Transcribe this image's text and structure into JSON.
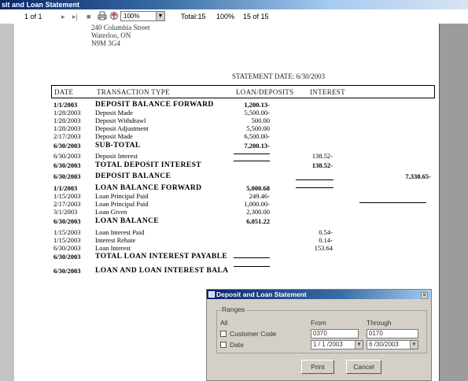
{
  "window": {
    "title": "sit and Loan Statement"
  },
  "toolbar": {
    "page_counter": "1 of 1",
    "next_glyph": "▸",
    "last_glyph": "▸|",
    "stop_glyph": "■",
    "zoom_value": "100%",
    "total_label": "Total:15",
    "total_pct": "100%",
    "records_label": "15 of 15"
  },
  "report": {
    "address": [
      "240 Columbia Street",
      "Waterloo, ON",
      "N9M 3G4"
    ],
    "statement_date": "STATEMENT DATE: 6/30/2003",
    "headers": {
      "date": "DATE",
      "type": "TRANSACTION TYPE",
      "loan": "LOAN/DEPOSITS",
      "interest": "INTEREST"
    },
    "rows": [
      {
        "date": "1/1/2003",
        "type": "DEPOSIT BALANCE FORWARD",
        "loan": "1,200.13-",
        "interest": "",
        "total": ""
      },
      {
        "date": "1/28/2003",
        "type": "Deposit Made",
        "loan": "5,500.00-",
        "interest": "",
        "total": ""
      },
      {
        "date": "1/28/2003",
        "type": "Deposit Withdrawl",
        "loan": "500.00",
        "interest": "",
        "total": ""
      },
      {
        "date": "1/28/2003",
        "type": "Deposit Adjustment",
        "loan": "5,500.00",
        "interest": "",
        "total": ""
      },
      {
        "date": "2/17/2003",
        "type": "Deposit Made",
        "loan": "6,500.00-",
        "interest": "",
        "total": ""
      },
      {
        "date": "6/30/2003",
        "type": "SUB-TOTAL",
        "loan": "7,200.13-",
        "interest": "",
        "total": ""
      },
      {
        "date": "6/30/2003",
        "type": "Deposit Interest",
        "loan": "",
        "interest": "138.52-",
        "total": ""
      },
      {
        "date": "6/30/2003",
        "type": "TOTAL DEPOSIT INTEREST",
        "loan": "",
        "interest": "138.52-",
        "total": ""
      },
      {
        "date": "6/30/2003",
        "type": "DEPOSIT BALANCE",
        "loan": "",
        "interest": "",
        "total": "7,338.65-"
      },
      {
        "date": "1/1/2003",
        "type": "LOAN BALANCE FORWARD",
        "loan": "5,000.68",
        "interest": "",
        "total": ""
      },
      {
        "date": "1/15/2003",
        "type": "Loan Principal Paid",
        "loan": "249.46-",
        "interest": "",
        "total": ""
      },
      {
        "date": "2/17/2003",
        "type": "Loan Principal Paid",
        "loan": "1,000.00-",
        "interest": "",
        "total": ""
      },
      {
        "date": "3/1/2003",
        "type": "Loan Given",
        "loan": "2,300.00",
        "interest": "",
        "total": ""
      },
      {
        "date": "6/30/2003",
        "type": "LOAN BALANCE",
        "loan": "6,051.22",
        "interest": "",
        "total": ""
      },
      {
        "date": "1/15/2003",
        "type": "Loan Interest Paid",
        "loan": "",
        "interest": "0.54-",
        "total": ""
      },
      {
        "date": "1/15/2003",
        "type": "Interest Rebate",
        "loan": "",
        "interest": "0.14-",
        "total": ""
      },
      {
        "date": "6/30/2003",
        "type": "Loan Interest",
        "loan": "",
        "interest": "153.64",
        "total": ""
      },
      {
        "date": "6/30/2003",
        "type": "TOTAL LOAN INTEREST PAYABLE",
        "loan": "",
        "interest": "",
        "total": ""
      },
      {
        "date": "6/30/2003",
        "type": "LOAN AND LOAN INTEREST BALA",
        "loan": "",
        "interest": "",
        "total": ""
      }
    ]
  },
  "dialog": {
    "title": "Deposit and Loan Statement",
    "close_glyph": "×",
    "ranges_label": "Ranges",
    "all_label": "All",
    "from_label": "From",
    "through_label": "Through",
    "customer_code_label": "Customer Code",
    "customer_from": "0370",
    "customer_through": "0170",
    "date_label": "Date",
    "date_from": "1 / 1 /2003",
    "date_through": "6 /30/2003",
    "print_label": "Print",
    "cancel_label": "Cancel"
  }
}
